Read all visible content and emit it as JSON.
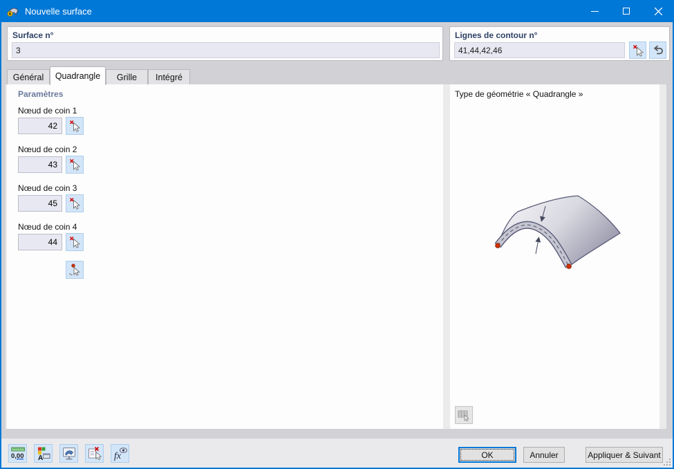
{
  "window": {
    "title": "Nouvelle surface"
  },
  "header": {
    "surface_label": "Surface n°",
    "surface_value": "3",
    "contour_label": "Lignes de contour n°",
    "contour_value": "41,44,42,46"
  },
  "tabs": [
    {
      "label": "Général",
      "active": false
    },
    {
      "label": "Quadrangle",
      "active": true
    },
    {
      "label": "Grille",
      "active": false
    },
    {
      "label": "Intégré",
      "active": false
    }
  ],
  "parameters": {
    "title": "Paramètres",
    "fields": [
      {
        "label": "Nœud de coin 1",
        "value": "42"
      },
      {
        "label": "Nœud de coin 2",
        "value": "43"
      },
      {
        "label": "Nœud de coin 3",
        "value": "45"
      },
      {
        "label": "Nœud de coin 4",
        "value": "44"
      }
    ]
  },
  "preview": {
    "title": "Type de géométrie « Quadrangle »"
  },
  "toolbar": {
    "units_icon_label": "0,00",
    "function_icon_label": "fx",
    "icons": [
      "units-decimal-settings",
      "display-properties",
      "view-options",
      "delete-via-pick",
      "function-comment"
    ]
  },
  "actions": {
    "ok": "OK",
    "cancel": "Annuler",
    "apply_next": "Appliquer & Suivant"
  },
  "colors": {
    "titlebar": "#0078d7",
    "accent_blue": "#0078d7",
    "picker_button_bg": "#d3e5f8",
    "input_bg": "#e8e8f2",
    "header_label": "#2e4265",
    "red_marker": "#d03000"
  }
}
